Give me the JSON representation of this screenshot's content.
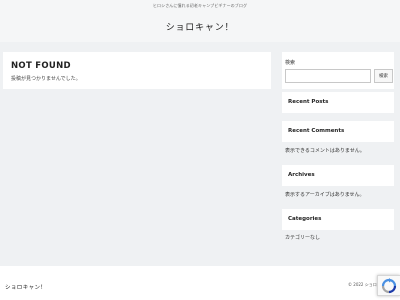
{
  "header": {
    "tagline": "ヒロシさんに憧れる初老キャンプビギナーのブログ",
    "site_title": "ショロキャン！"
  },
  "main": {
    "heading": "NOT FOUND",
    "message": "投稿が見つかりませんでした。"
  },
  "sidebar": {
    "search": {
      "label": "検索",
      "value": "",
      "placeholder": "",
      "button_label": "検索"
    },
    "recent_posts": {
      "title": "Recent Posts"
    },
    "recent_comments": {
      "title": "Recent Comments",
      "empty_text": "表示できるコメントはありません。"
    },
    "archives": {
      "title": "Archives",
      "empty_text": "表示するアーカイブはありません。"
    },
    "categories": {
      "title": "Categories",
      "empty_text": "カテゴリーなし"
    }
  },
  "footer": {
    "site_title": "ショロキャン！",
    "copyright": "© 2022 ショロ"
  },
  "icons": {
    "recaptcha": "recaptcha-icon"
  },
  "colors": {
    "background": "#eff1f3",
    "card": "#ffffff",
    "recaptcha_blue": "#4a90e2"
  }
}
